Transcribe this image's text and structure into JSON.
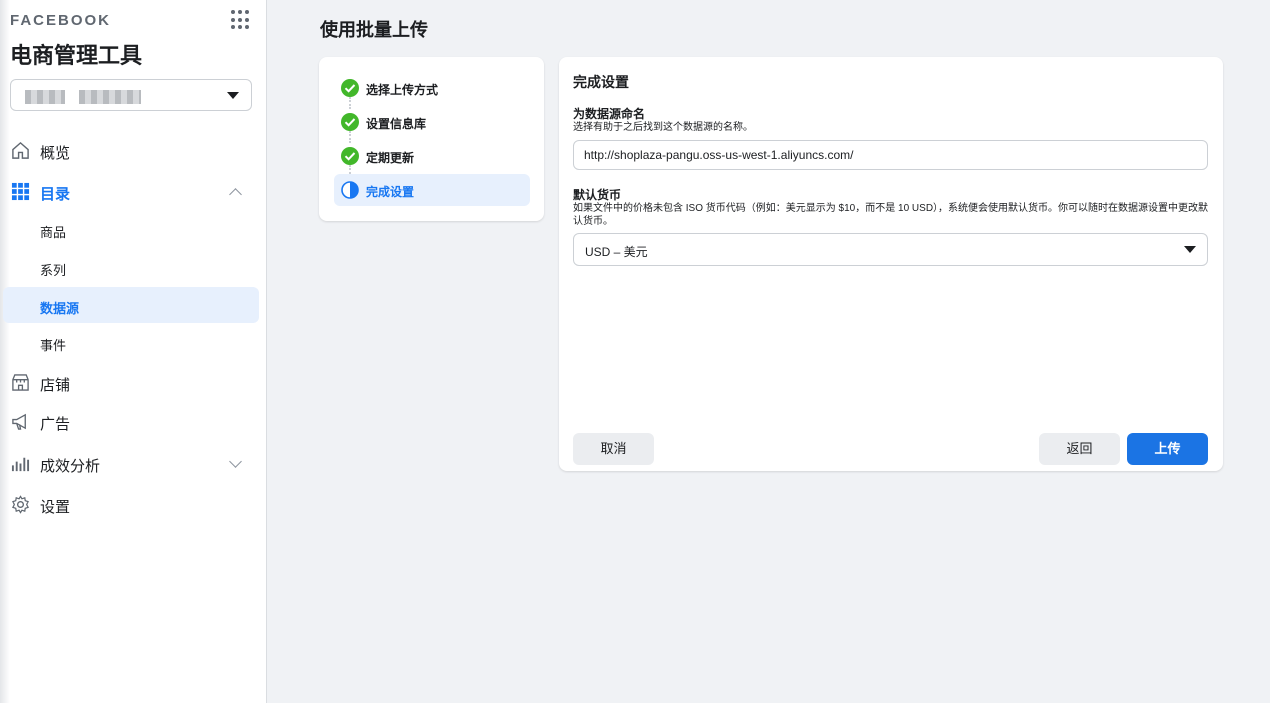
{
  "sidebar": {
    "brand": "FACEBOOK",
    "app_title": "电商管理工具",
    "nav": {
      "overview": "概览",
      "catalog": "目录",
      "catalog_items": [
        "商品",
        "系列",
        "数据源",
        "事件"
      ],
      "shop": "店铺",
      "ads": "广告",
      "insights": "成效分析",
      "settings": "设置"
    }
  },
  "main": {
    "page_title": "使用批量上传",
    "steps": [
      {
        "label": "选择上传方式",
        "status": "complete"
      },
      {
        "label": "设置信息库",
        "status": "complete"
      },
      {
        "label": "定期更新",
        "status": "complete"
      },
      {
        "label": "完成设置",
        "status": "in-progress"
      }
    ],
    "form": {
      "heading": "完成设置",
      "name_label": "为数据源命名",
      "name_help": "选择有助于之后找到这个数据源的名称。",
      "name_value": "http://shoplaza-pangu.oss-us-west-1.aliyuncs.com/",
      "currency_label": "默认货币",
      "currency_help": "如果文件中的价格未包含 ISO 货币代码（例如：美元显示为 $10，而不是 10 USD），系统便会使用默认货币。你可以随时在数据源设置中更改默认货币。",
      "currency_value": "USD – 美元",
      "cancel": "取消",
      "back": "返回",
      "upload": "上传"
    }
  },
  "colors": {
    "accent": "#1877f2",
    "primary_button": "#1b74e4",
    "check_green": "#42b72a",
    "active_bg": "#e7f0fd"
  }
}
